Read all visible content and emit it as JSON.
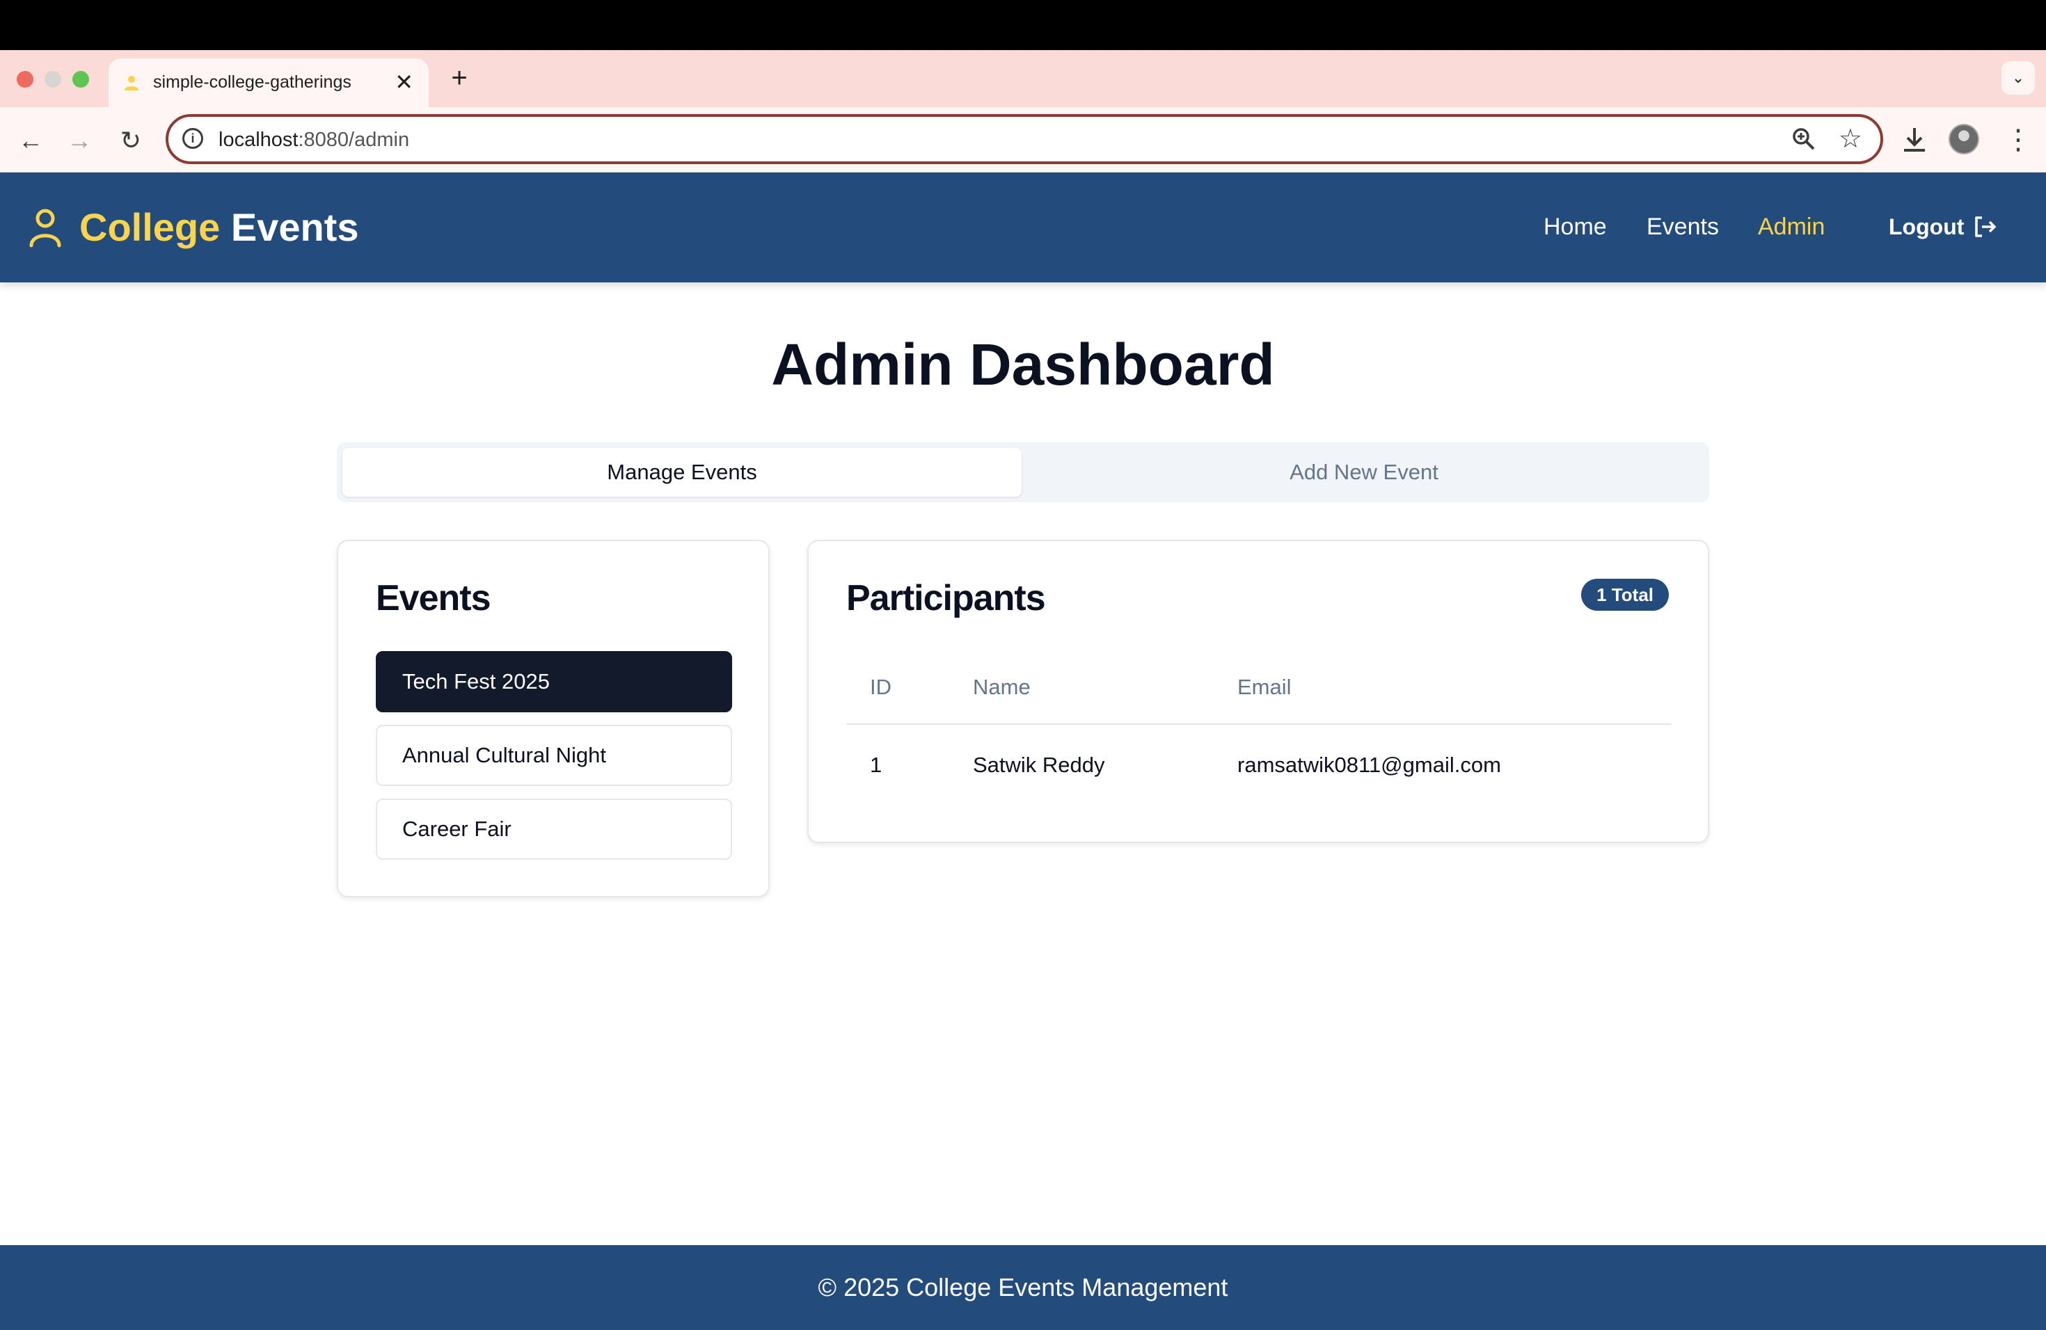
{
  "browser": {
    "tab_title": "simple-college-gatherings",
    "tab_close": "✕",
    "new_tab": "+",
    "url_host": "localhost",
    "url_path": ":8080/admin",
    "icons": [
      "back-icon",
      "forward-icon",
      "reload-icon",
      "info-icon",
      "zoom-icon",
      "star-icon",
      "download-icon",
      "profile-avatar",
      "more-icon"
    ]
  },
  "header": {
    "brand_part1": "College",
    "brand_part2": "Events",
    "nav": {
      "home": "Home",
      "events": "Events",
      "admin": "Admin"
    },
    "logout": "Logout",
    "colors": {
      "bg": "#234b7c",
      "accent": "#fcd34d"
    }
  },
  "main": {
    "title": "Admin Dashboard",
    "tabs": {
      "manage": "Manage Events",
      "add": "Add New Event",
      "active": "manage"
    },
    "events_card": {
      "title": "Events",
      "items": [
        {
          "label": "Tech Fest 2025",
          "active": true
        },
        {
          "label": "Annual Cultural Night",
          "active": false
        },
        {
          "label": "Career Fair",
          "active": false
        }
      ]
    },
    "participants_card": {
      "title": "Participants",
      "badge": "1 Total",
      "columns": {
        "id": "ID",
        "name": "Name",
        "email": "Email"
      },
      "rows": [
        {
          "id": "1",
          "name": "Satwik Reddy",
          "email": "ramsatwik0811@gmail.com"
        }
      ]
    }
  },
  "footer": {
    "text": "© 2025 College Events Management"
  }
}
